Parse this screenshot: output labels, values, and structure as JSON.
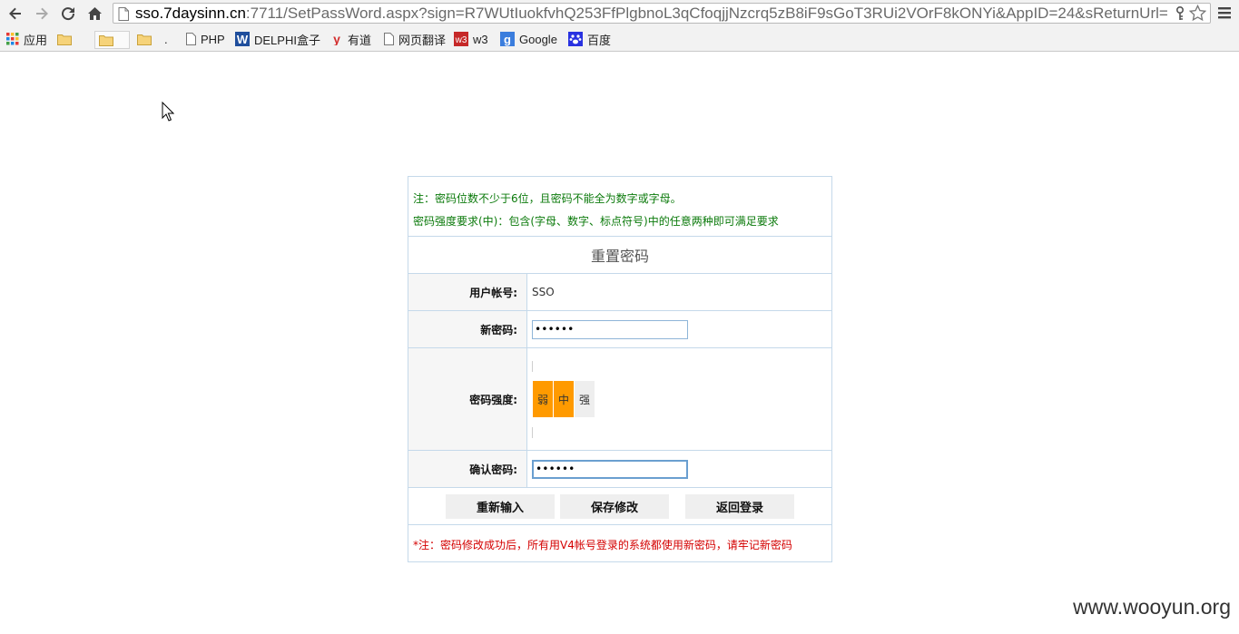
{
  "browser": {
    "url_host": "sso.7daysinn.cn",
    "url_path": ":7711/SetPassWord.aspx?sign=R7WUtIuokfvhQ253FfPlgbnoL3qCfoqjjNzcrq5zB8iF9sGoT3RUi2VOrF8kONYi&AppID=24&sReturnUrl=",
    "bookmarks": [
      {
        "label": "应用",
        "icon": "apps-grid-icon"
      },
      {
        "label": "",
        "icon": "folder-icon"
      },
      {
        "label": "",
        "icon": "folder-icon"
      },
      {
        "label": ".",
        "icon": "folder-icon"
      },
      {
        "label": "PHP",
        "icon": "page-icon"
      },
      {
        "label": "DELPHI盒子",
        "icon": "delphi-w-icon"
      },
      {
        "label": "有道",
        "icon": "youdao-icon"
      },
      {
        "label": "网页翻译",
        "icon": "page-icon"
      },
      {
        "label": "w3",
        "icon": "w3-icon"
      },
      {
        "label": "Google",
        "icon": "google-icon"
      },
      {
        "label": "百度",
        "icon": "baidu-paw-icon"
      }
    ]
  },
  "notes": {
    "line1": "注：密码位数不少于6位，且密码不能全为数字或字母。",
    "line2": "密码强度要求(中)：包含(字母、数字、标点符号)中的任意两种即可满足要求"
  },
  "form": {
    "title": "重置密码",
    "account_label": "用户帐号:",
    "account_value": "SSO",
    "new_password_label": "新密码:",
    "new_password_value": "••••••",
    "strength_label": "密码强度:",
    "strength_levels": [
      "弱",
      "中",
      "强"
    ],
    "strength_current": "中",
    "confirm_label": "确认密码:",
    "confirm_value": "••••••"
  },
  "buttons": {
    "reset": "重新输入",
    "save": "保存修改",
    "back": "返回登录"
  },
  "footnote": "*注：密码修改成功后，所有用V4帐号登录的系统都使用新密码，请牢记新密码",
  "watermark": "www.wooyun.org",
  "colors": {
    "note_green": "#0b7a0b",
    "footnote_red": "#d40000",
    "strength_orange": "#ff9a00",
    "border_blue": "#c5d9ea"
  }
}
